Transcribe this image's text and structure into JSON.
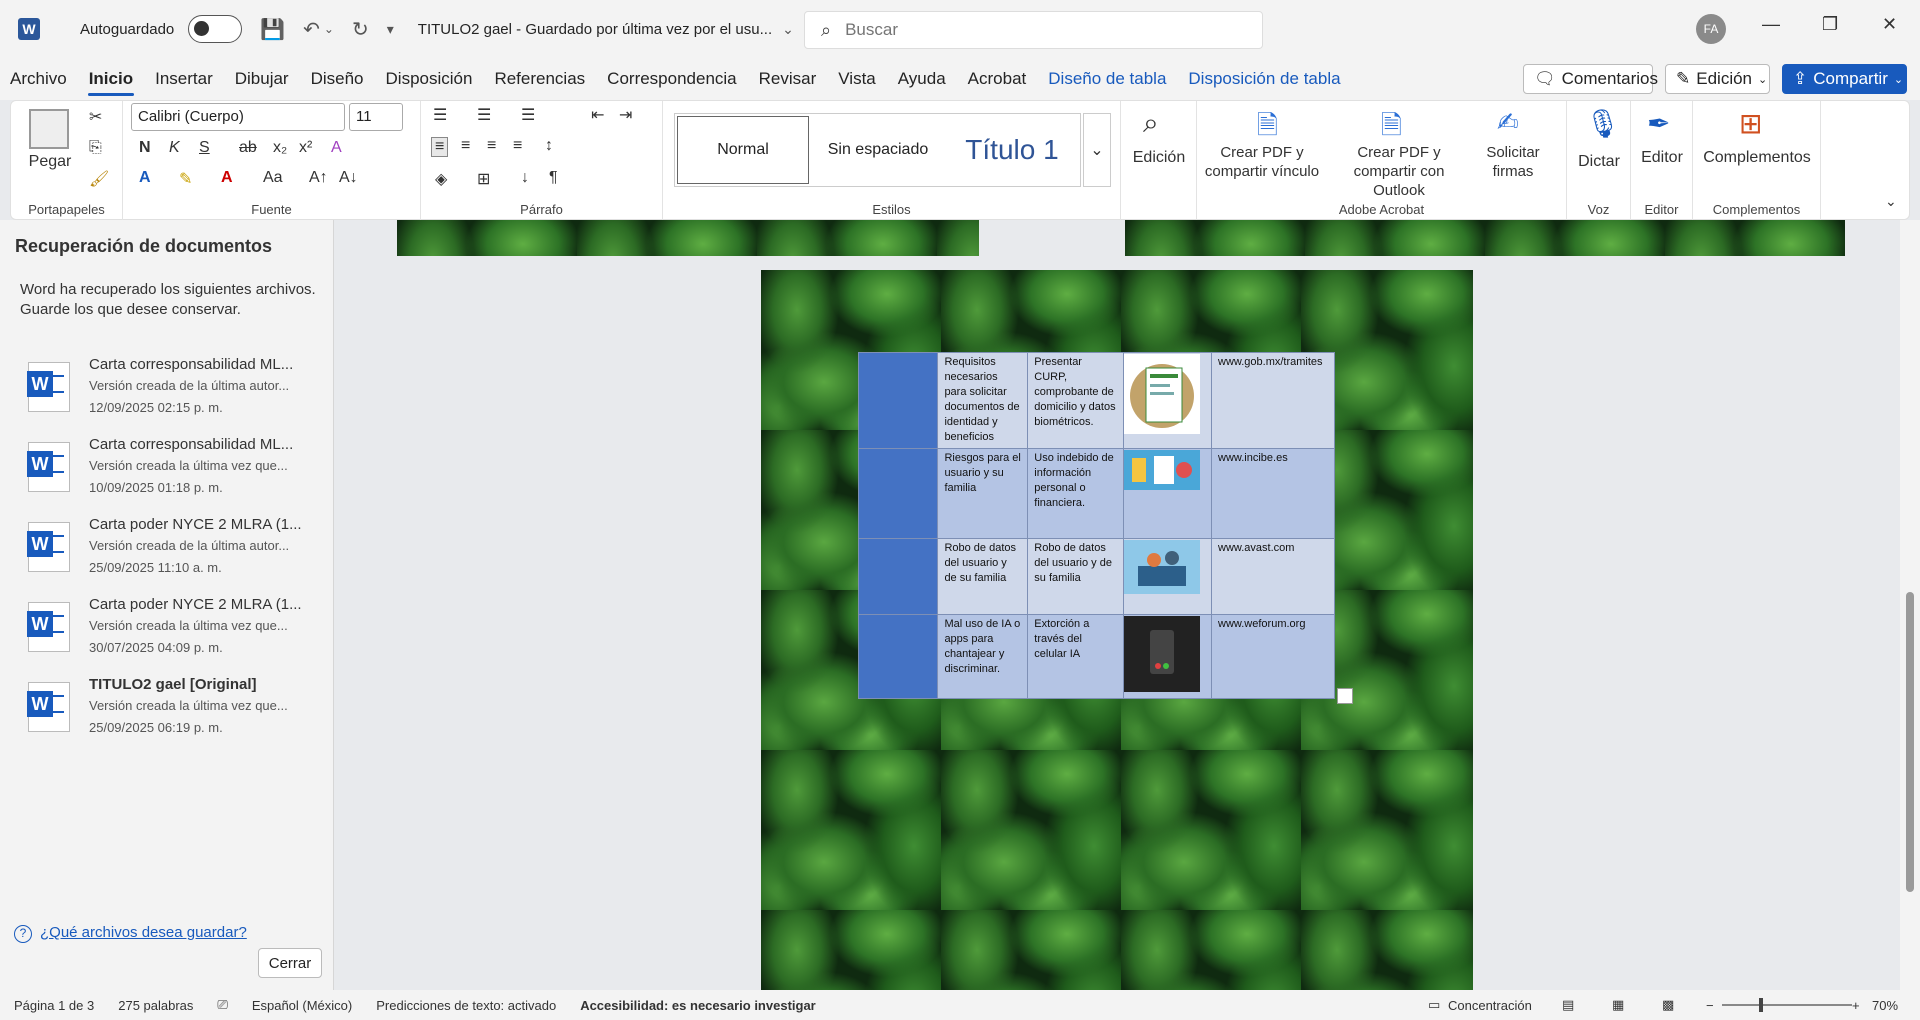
{
  "titlebar": {
    "autosave_label": "Autoguardado",
    "doc_title": "TITULO2 gael  -  Guardado por última vez por el usu...",
    "search_placeholder": "Buscar",
    "avatar_initials": "FA"
  },
  "menu": [
    "Archivo",
    "Inicio",
    "Insertar",
    "Dibujar",
    "Diseño",
    "Disposición",
    "Referencias",
    "Correspondencia",
    "Revisar",
    "Vista",
    "Ayuda",
    "Acrobat"
  ],
  "menu_context": [
    "Diseño de tabla",
    "Disposición de tabla"
  ],
  "right_buttons": {
    "comments": "Comentarios",
    "editing": "Edición",
    "share": "Compartir"
  },
  "ribbon": {
    "paste_label": "Pegar",
    "clipboard_group": "Portapapeles",
    "font_name": "Calibri (Cuerpo)",
    "font_size": "11",
    "font_group": "Fuente",
    "paragraph_group": "Párrafo",
    "styles": [
      "Normal",
      "Sin espaciado",
      "Título 1"
    ],
    "styles_group": "Estilos",
    "edit_label": "Edición",
    "acrobat_btn1": "Crear PDF y compartir vínculo",
    "acrobat_btn2": "Crear PDF y compartir con Outlook",
    "acrobat_btn3": "Solicitar firmas",
    "acrobat_group": "Adobe Acrobat",
    "dictate_label": "Dictar",
    "voice_group": "Voz",
    "editor_label": "Editor",
    "editor_group": "Editor",
    "addins_label": "Complementos",
    "addins_group": "Complementos"
  },
  "recovery": {
    "title": "Recuperación de documentos",
    "description": "Word ha recuperado los siguientes archivos. Guarde los que desee conservar.",
    "files": [
      {
        "name": "Carta corresponsabilidad ML...",
        "sub": "Versión creada de la última autor...",
        "date": "12/09/2025 02:15 p. m."
      },
      {
        "name": "Carta corresponsabilidad ML...",
        "sub": "Versión creada la última vez que...",
        "date": "10/09/2025 01:18 p. m."
      },
      {
        "name": "Carta poder NYCE 2  MLRA (1...",
        "sub": "Versión creada de la última autor...",
        "date": "25/09/2025 11:10 a. m."
      },
      {
        "name": "Carta poder NYCE 2  MLRA (1...",
        "sub": "Versión creada la última vez que...",
        "date": "30/07/2025 04:09 p. m."
      },
      {
        "name": "TITULO2 gael  [Original]",
        "sub": "Versión creada la última vez que...",
        "date": "25/09/2025 06:19 p. m."
      }
    ],
    "help_link": "¿Qué archivos desea guardar?",
    "close_label": "Cerrar"
  },
  "table": {
    "rows": [
      {
        "c1": "Requisitos necesarios para solicitar documentos de identidad y beneficios",
        "c2": "Presentar CURP, comprobante de domicilio y datos biométricos.",
        "c4": "www.gob.mx/tramites"
      },
      {
        "c1": "Riesgos para el usuario y su familia",
        "c2": "Uso indebido de información personal o financiera.",
        "c4": "www.incibe.es"
      },
      {
        "c1": "Robo de datos del usuario y de su familia",
        "c2": "Robo de datos del usuario y de su familia",
        "c4": "www.avast.com"
      },
      {
        "c1": "Mal uso de IA o apps para chantajear y discriminar.",
        "c2": "Extorción a través del celular IA",
        "c4": "www.weforum.org"
      }
    ]
  },
  "status": {
    "page": "Página 1 de 3",
    "words": "275 palabras",
    "language": "Español (México)",
    "predictions": "Predicciones de texto: activado",
    "accessibility": "Accesibilidad: es necesario investigar",
    "focus": "Concentración",
    "zoom": "70%"
  },
  "colors": {
    "accent": "#185abd",
    "table_blue": "#4472c4"
  }
}
